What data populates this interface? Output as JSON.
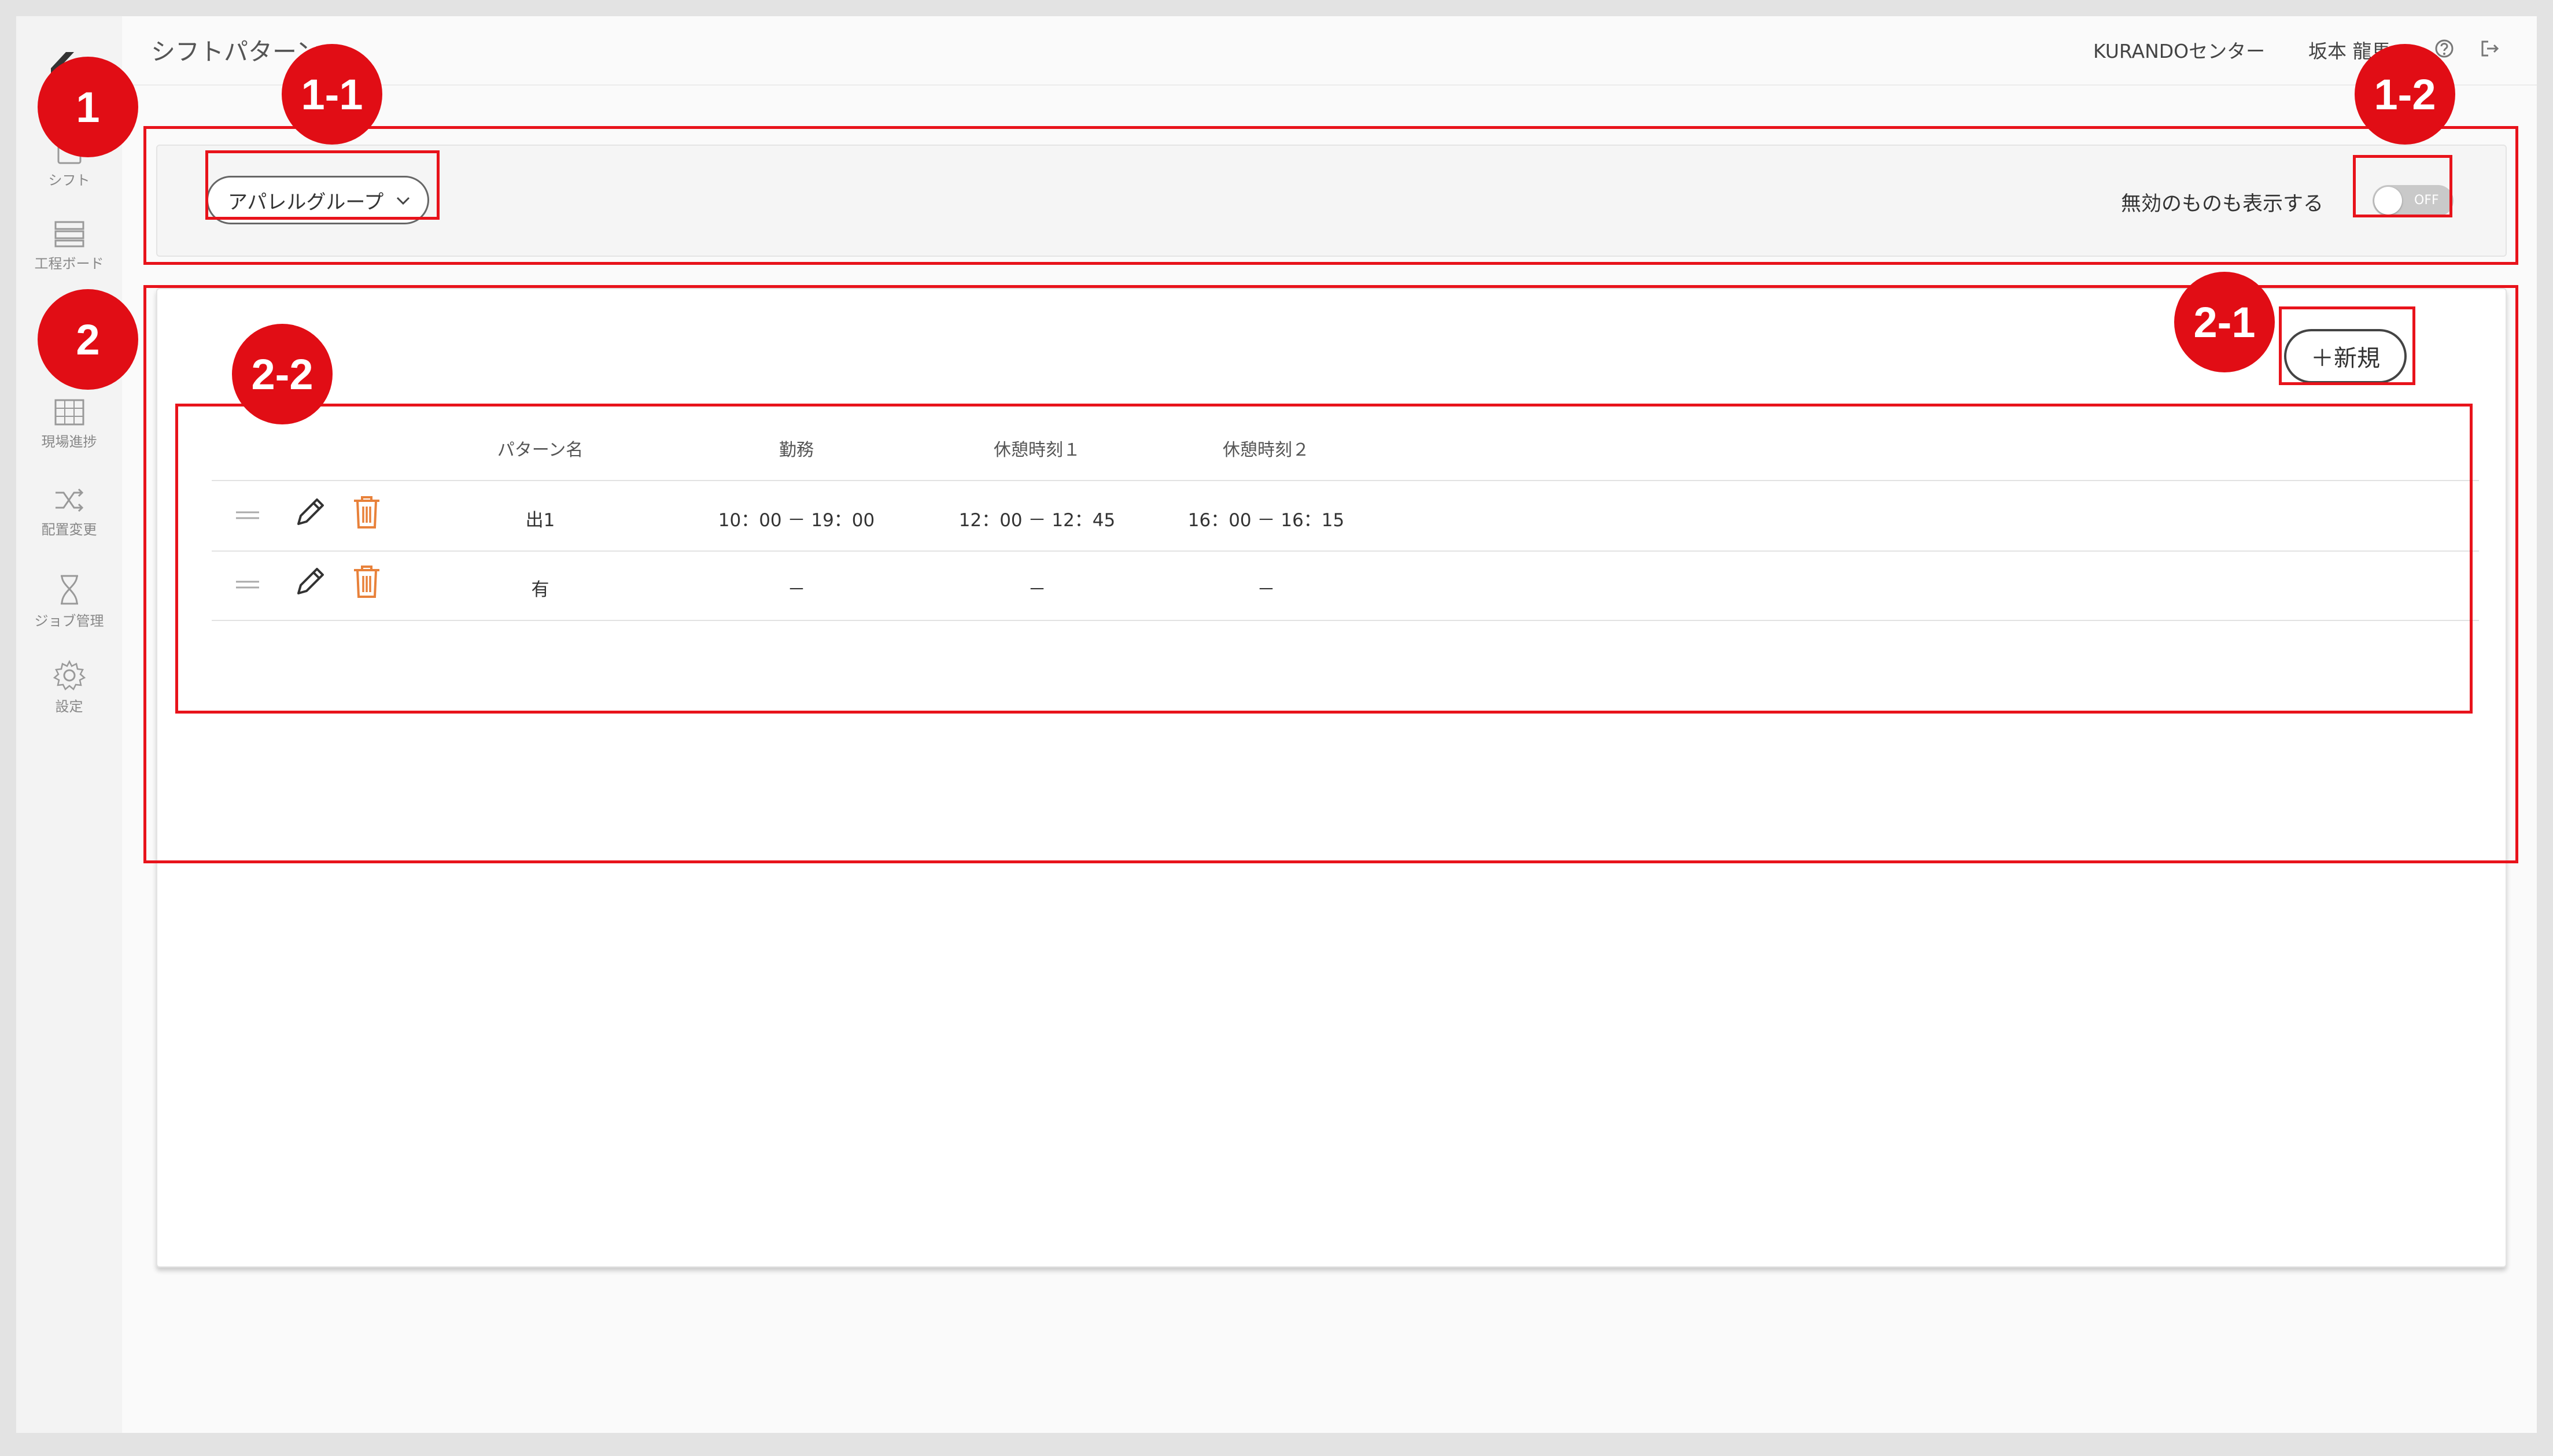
{
  "header": {
    "page_title": "シフトパターン",
    "center_name": "KURANDOセンター",
    "user_name": "坂本 龍馬"
  },
  "sidebar": {
    "items": [
      {
        "label": "シフト",
        "icon": "calendar-icon"
      },
      {
        "label": "工程ボード",
        "icon": "board-icon"
      },
      {
        "label": "現場進捗",
        "icon": "grid-icon"
      },
      {
        "label": "配置変更",
        "icon": "shuffle-icon"
      },
      {
        "label": "ジョブ管理",
        "icon": "hourglass-icon"
      },
      {
        "label": "設定",
        "icon": "gear-icon"
      }
    ]
  },
  "filter": {
    "group_select_value": "アパレルグループ",
    "toggle_label": "無効のものも表示する",
    "toggle_state": "OFF"
  },
  "card": {
    "new_button_label": "＋新規"
  },
  "table": {
    "headers": [
      "パターン名",
      "勤務",
      "休憩時刻１",
      "休憩時刻２"
    ],
    "rows": [
      {
        "name": "出1",
        "work": "10：00 － 19：00",
        "break1": "12：00 － 12：45",
        "break2": "16：00 － 16：15"
      },
      {
        "name": "有",
        "work": "－",
        "break1": "－",
        "break2": "－"
      }
    ]
  },
  "annotations": {
    "badges": [
      "1",
      "1-1",
      "1-2",
      "2",
      "2-1",
      "2-2"
    ]
  },
  "colors": {
    "annotation_red": "#e8131b",
    "delete_icon_orange": "#e8813a",
    "toggle_off": "#c9c9c9"
  }
}
